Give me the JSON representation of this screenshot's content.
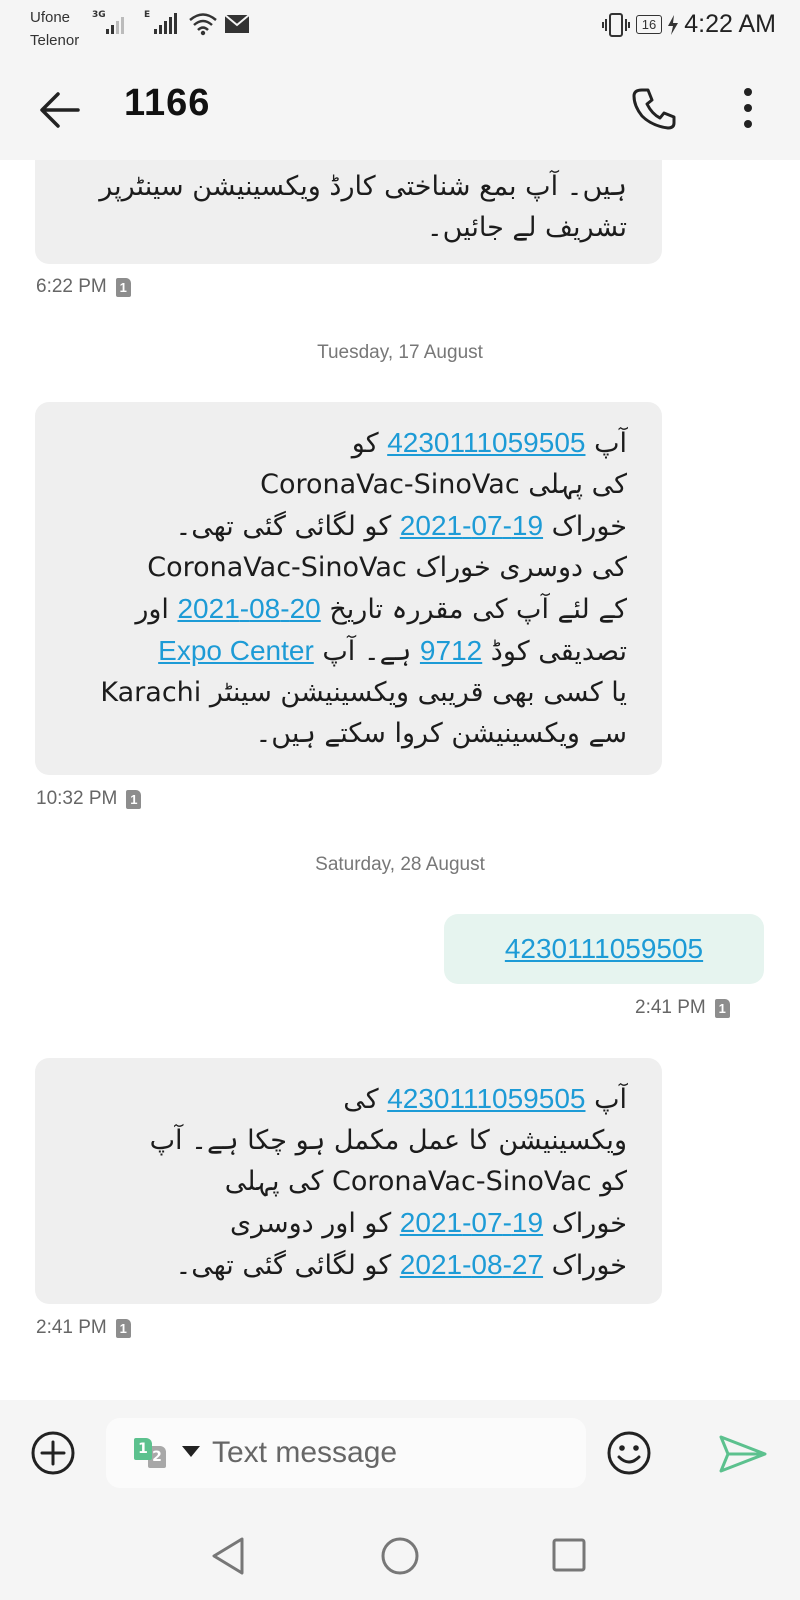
{
  "status_bar": {
    "carriers": [
      "Ufone",
      "Telenor"
    ],
    "sim1_network": "3G",
    "sim2_network": "E",
    "battery": "16",
    "time": "4:22 AM"
  },
  "app_bar": {
    "title": "1166",
    "back_icon": "arrow-left-icon",
    "call_icon": "phone-icon",
    "menu_icon": "more-vertical-icon"
  },
  "messages": {
    "m1": {
      "lines": [
        "ہیں۔ آپ بمع شناختی کارڈ ویکسینیشن سینٹرپر",
        "تشریف لے جائیں۔"
      ],
      "time": "6:22 PM",
      "sim": "1"
    },
    "sep1": "Tuesday, 17 August",
    "m2": {
      "l1_pre": "آپ ",
      "l1_link": "4230111059505",
      "l1_post": " کو",
      "l2": "CoronaVac-SinoVac کی پہلی",
      "l3_pre": "خوراک ",
      "l3_link": "19-07-2021",
      "l3_post": " کو لگائی گئی تھی۔",
      "l4": "CoronaVac-SinoVac کی دوسری خوراک",
      "l5_pre": "کے لئے آپ کی مقررہ تاریخ ",
      "l5_link": "20-08-2021",
      "l5_post": " اور",
      "l6_pre": "تصدیقی کوڈ ",
      "l6_link": "9712",
      "l6_mid": " ہے۔ آپ ",
      "l6_link2": "Expo Center",
      "l7": "Karachi یا کسی بھی قریبی ویکسینیشن سینٹر",
      "l8": "سے ویکسینیشن کروا سکتے ہیں۔",
      "time": "10:32 PM",
      "sim": "1"
    },
    "sep2": "Saturday, 28 August",
    "m3": {
      "link": "4230111059505",
      "time": "2:41 PM",
      "sim": "1"
    },
    "m4": {
      "l1_pre": "آپ ",
      "l1_link": "4230111059505",
      "l1_post": " کی",
      "l2": "ویکسینیشن کا عمل مکمل ہو چکا ہے۔ آپ",
      "l3": "کو CoronaVac-SinoVac کی پہلی",
      "l4_pre": "خوراک  ",
      "l4_link": "19-07-2021",
      "l4_post": "  کو اور دوسری",
      "l5_pre": "خوراک ",
      "l5_link": "27-08-2021",
      "l5_post": " کو لگائی گئی تھی۔",
      "time": "2:41 PM",
      "sim": "1"
    }
  },
  "composer": {
    "placeholder": "Text message",
    "sim_primary": "1",
    "sim_secondary": "2",
    "add_icon": "plus-circle-icon",
    "emoji_icon": "smiley-icon",
    "send_icon": "send-icon"
  },
  "nav_bar": {
    "back_icon": "nav-back-icon",
    "home_icon": "nav-home-icon",
    "recents_icon": "nav-recents-icon"
  }
}
